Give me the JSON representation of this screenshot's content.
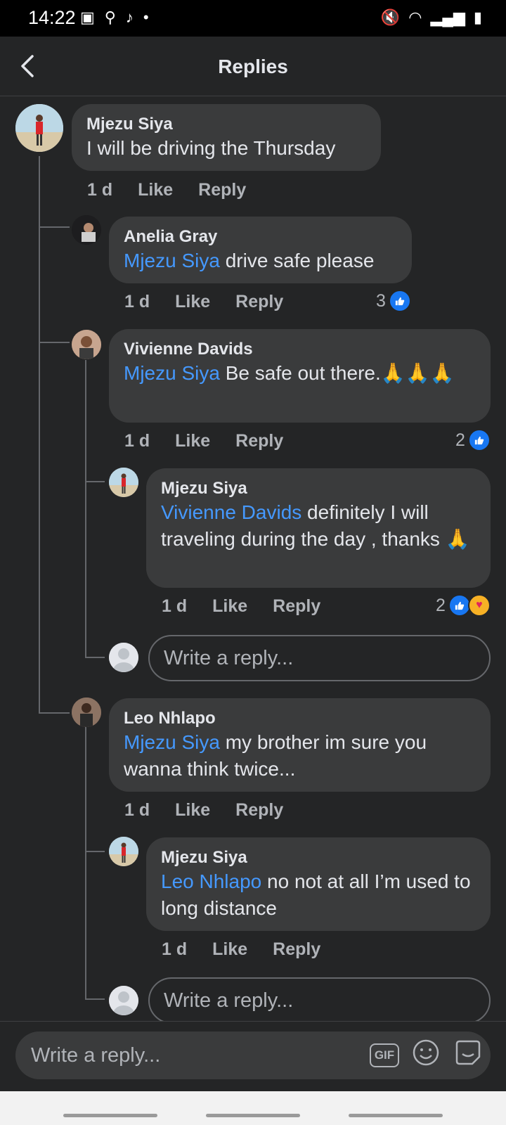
{
  "status_bar": {
    "time": "14:22"
  },
  "header": {
    "title": "Replies",
    "back_icon": "chevron-left-icon"
  },
  "comments": [
    {
      "author": "Mjezu Siya",
      "text": "I will be driving the Thursday",
      "time": "1 d",
      "like": "Like",
      "reply": "Reply"
    },
    {
      "author": "Anelia Gray",
      "mention": "Mjezu Siya",
      "text": " drive safe please",
      "time": "1 d",
      "like": "Like",
      "reply": "Reply",
      "reactions": "3"
    },
    {
      "author": "Vivienne Davids",
      "mention": "Mjezu Siya",
      "text": " Be safe out there.🙏🙏🙏",
      "time": "1 d",
      "like": "Like",
      "reply": "Reply",
      "reactions": "2"
    },
    {
      "author": "Mjezu Siya",
      "mention": "Vivienne Davids",
      "text": " definitely I will traveling during the day , thanks 🙏",
      "time": "1 d",
      "like": "Like",
      "reply": "Reply",
      "reactions": "2"
    },
    {
      "author": "Leo Nhlapo",
      "mention": "Mjezu Siya",
      "text": " my brother im sure you wanna think twice...",
      "time": "1 d",
      "like": "Like",
      "reply": "Reply"
    },
    {
      "author": "Mjezu Siya",
      "mention": "Leo Nhlapo",
      "text": " no not at all I’m used to long distance",
      "time": "1 d",
      "like": "Like",
      "reply": "Reply"
    }
  ],
  "reply_placeholder": "Write a reply...",
  "bottom": {
    "placeholder": "Write a reply...",
    "gif_label": "GIF"
  },
  "colors": {
    "background": "#242526",
    "bubble": "#3a3b3c",
    "mention": "#4599ff",
    "like_blue": "#1877f2"
  }
}
